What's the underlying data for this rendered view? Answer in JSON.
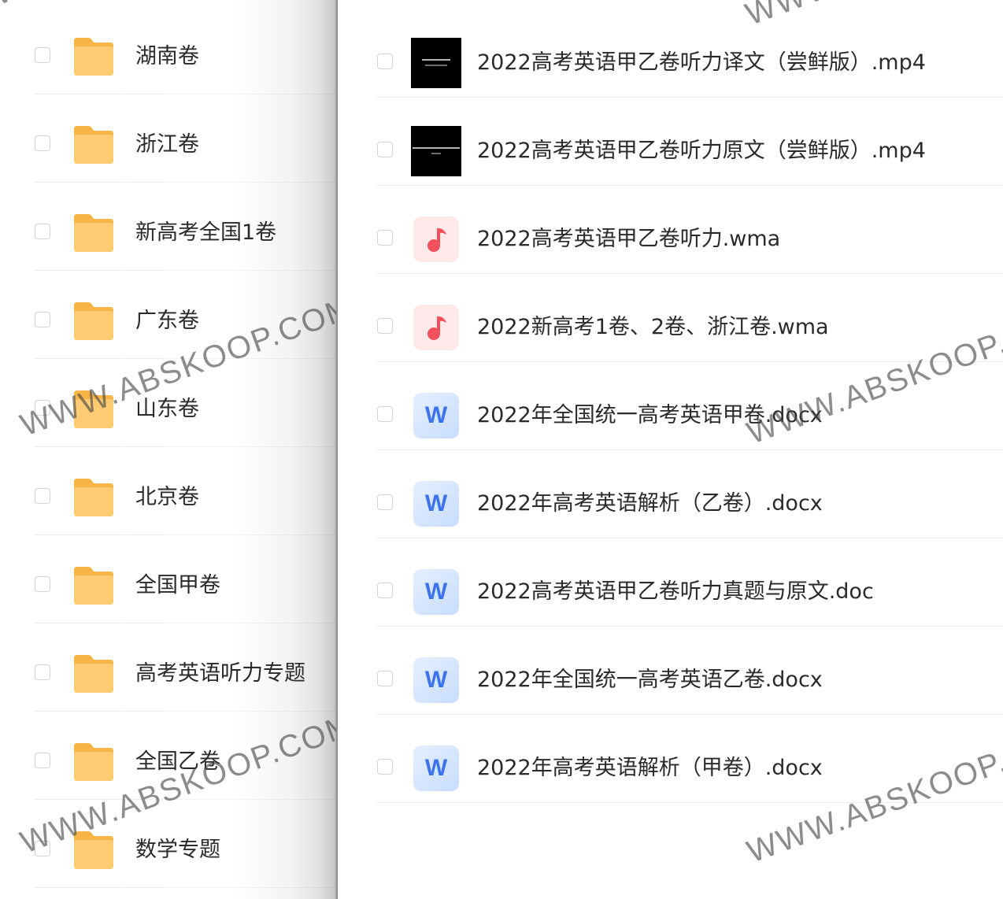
{
  "left_panel": {
    "folders": [
      {
        "label": "湖南卷"
      },
      {
        "label": "浙江卷"
      },
      {
        "label": "新高考全国1卷"
      },
      {
        "label": "广东卷"
      },
      {
        "label": "山东卷"
      },
      {
        "label": "北京卷"
      },
      {
        "label": "全国甲卷"
      },
      {
        "label": "高考英语听力专题"
      },
      {
        "label": "全国乙卷"
      },
      {
        "label": "数学专题"
      }
    ]
  },
  "right_panel": {
    "files": [
      {
        "label": "2022高考英语甲乙卷听力译文（尝鲜版）.mp4",
        "icon": "video-thumbnail"
      },
      {
        "label": "2022高考英语甲乙卷听力原文（尝鲜版）.mp4",
        "icon": "video-thumbnail"
      },
      {
        "label": "2022高考英语甲乙卷听力.wma",
        "icon": "music-note-icon"
      },
      {
        "label": "2022新高考1卷、2卷、浙江卷.wma",
        "icon": "music-note-icon"
      },
      {
        "label": "2022年全国统一高考英语甲卷.docx",
        "icon": "word-doc-icon"
      },
      {
        "label": "2022年高考英语解析（乙卷）.docx",
        "icon": "word-doc-icon"
      },
      {
        "label": "2022高考英语甲乙卷听力真题与原文.doc",
        "icon": "word-doc-icon"
      },
      {
        "label": "2022年全国统一高考英语乙卷.docx",
        "icon": "word-doc-icon"
      },
      {
        "label": "2022年高考英语解析（甲卷）.docx",
        "icon": "word-doc-icon"
      }
    ]
  },
  "word_icon_letter": "W",
  "watermark_text": "WWW.ABSKOOP.COM",
  "colors": {
    "folder_yellow": "#fbc566",
    "audio_red": "#f0505a",
    "word_blue": "#3a72f0"
  }
}
